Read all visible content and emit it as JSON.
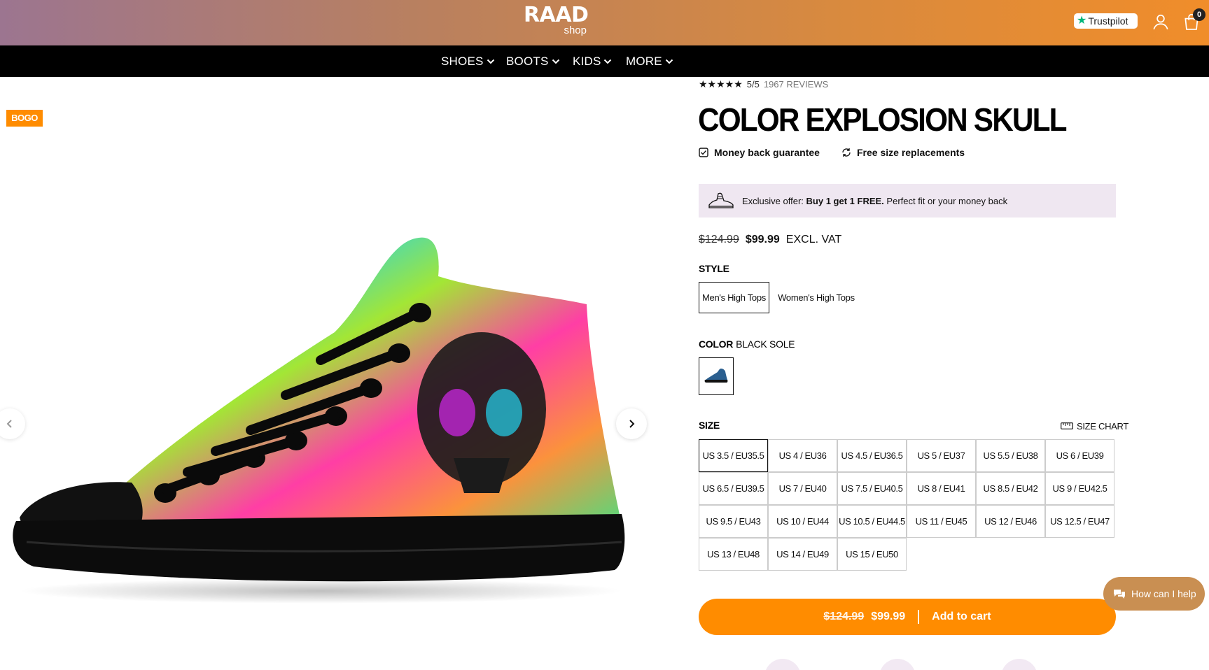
{
  "header": {
    "logo_main": "RAAD",
    "logo_sub": "shop",
    "trustpilot_label": "Trustpilot",
    "cart_count": "0",
    "icons": [
      "trustpilot-star-icon",
      "user-icon",
      "cart-icon"
    ]
  },
  "nav": {
    "items": [
      {
        "label": "SHOES"
      },
      {
        "label": "BOOTS"
      },
      {
        "label": "KIDS"
      },
      {
        "label": "MORE"
      }
    ]
  },
  "gallery": {
    "badge": "BOGO"
  },
  "product": {
    "rating_stars": "★★★★★",
    "rating": "5/5",
    "reviews": "1967 REVIEWS",
    "title": "COLOR EXPLOSION SKULL",
    "guarantee_1": "Money back guarantee",
    "guarantee_2": "Free size replacements",
    "offer_prefix": "Exclusive offer:",
    "offer_bold": "Buy 1 get 1 FREE.",
    "offer_suffix": "Perfect fit or your money back",
    "price_old": "$124.99",
    "price_new": "$99.99",
    "price_note": "EXCL. VAT",
    "style_label": "STYLE",
    "styles": [
      {
        "label": "Men's High Tops",
        "selected": true
      },
      {
        "label": "Women's High Tops",
        "selected": false
      }
    ],
    "color_label": "COLOR",
    "color_value": "BLACK SOLE",
    "size_label": "SIZE",
    "size_chart_label": "SIZE CHART",
    "sizes": [
      "US 3.5 / EU35.5",
      "US 4 / EU36",
      "US 4.5 / EU36.5",
      "US 5 / EU37",
      "US 5.5 / EU38",
      "US 6 / EU39",
      "US 6.5 / EU39.5",
      "US 7 / EU40",
      "US 7.5 / EU40.5",
      "US 8 / EU41",
      "US 8.5 / EU42",
      "US 9 / EU42.5",
      "US 9.5 / EU43",
      "US 10 / EU44",
      "US 10.5 / EU44.5",
      "US 11 / EU45",
      "US 12 / EU46",
      "US 12.5 / EU47",
      "US 13 / EU48",
      "US 14 / EU49",
      "US 15 / EU50"
    ],
    "selected_size": "US 3.5 / EU35.5"
  },
  "cart_button": {
    "price_old": "$124.99",
    "price_new": "$99.99",
    "label": "Add to cart"
  },
  "chat": {
    "label": "How can I help"
  },
  "colors": {
    "accent": "#ff8c00",
    "nav_bg": "#000000",
    "offer_bg": "#efe7f1"
  }
}
